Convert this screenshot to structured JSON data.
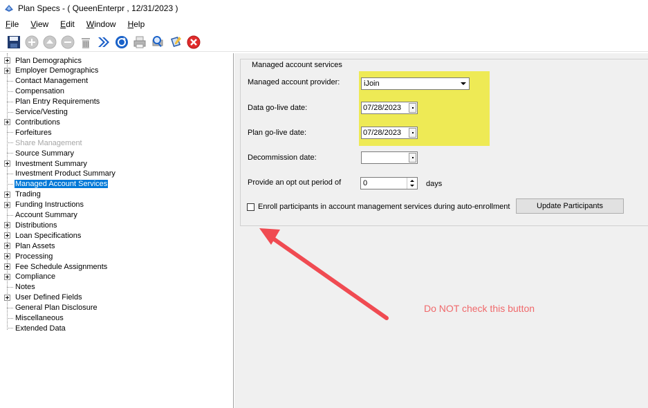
{
  "window": {
    "title": "Plan Specs -  ( QueenEnterpr , 12/31/2023 )",
    "app_icon": "plan-specs-app-icon"
  },
  "menu": {
    "items": [
      {
        "label": "File"
      },
      {
        "label": "View"
      },
      {
        "label": "Edit"
      },
      {
        "label": "Window"
      },
      {
        "label": "Help"
      }
    ]
  },
  "toolbar": {
    "buttons": [
      {
        "icon": "save-icon"
      },
      {
        "icon": "add-icon"
      },
      {
        "icon": "move-up-icon"
      },
      {
        "icon": "remove-icon"
      },
      {
        "icon": "delete-icon"
      },
      {
        "icon": "forward-icon"
      },
      {
        "icon": "refresh-icon"
      },
      {
        "icon": "print-icon"
      },
      {
        "icon": "print-preview-icon"
      },
      {
        "icon": "notes-icon"
      },
      {
        "icon": "close-icon"
      }
    ]
  },
  "tree": {
    "items": [
      {
        "label": "Plan Demographics",
        "expandable": true
      },
      {
        "label": "Employer Demographics",
        "expandable": true
      },
      {
        "label": "Contact Management",
        "expandable": false
      },
      {
        "label": "Compensation",
        "expandable": false
      },
      {
        "label": "Plan Entry Requirements",
        "expandable": false
      },
      {
        "label": "Service/Vesting",
        "expandable": false
      },
      {
        "label": "Contributions",
        "expandable": true
      },
      {
        "label": "Forfeitures",
        "expandable": false
      },
      {
        "label": "Share Management",
        "expandable": false,
        "disabled": true
      },
      {
        "label": "Source Summary",
        "expandable": false
      },
      {
        "label": "Investment Summary",
        "expandable": true
      },
      {
        "label": "Investment Product Summary",
        "expandable": false
      },
      {
        "label": "Managed Account Services",
        "expandable": false,
        "selected": true
      },
      {
        "label": "Trading",
        "expandable": true
      },
      {
        "label": "Funding Instructions",
        "expandable": true
      },
      {
        "label": "Account Summary",
        "expandable": false
      },
      {
        "label": "Distributions",
        "expandable": true
      },
      {
        "label": "Loan Specifications",
        "expandable": true
      },
      {
        "label": "Plan Assets",
        "expandable": true
      },
      {
        "label": "Processing",
        "expandable": true
      },
      {
        "label": "Fee Schedule Assignments",
        "expandable": true
      },
      {
        "label": "Compliance",
        "expandable": true
      },
      {
        "label": "Notes",
        "expandable": false
      },
      {
        "label": "User Defined Fields",
        "expandable": true
      },
      {
        "label": "General Plan Disclosure",
        "expandable": false
      },
      {
        "label": "Miscellaneous",
        "expandable": false
      },
      {
        "label": "Extended Data",
        "expandable": false
      }
    ]
  },
  "form": {
    "group_title": "Managed account services",
    "provider_label": "Managed account provider:",
    "provider_value": "iJoin",
    "data_golive_label": "Data go-live date:",
    "data_golive_value": "07/28/2023",
    "plan_golive_label": "Plan go-live date:",
    "plan_golive_value": "07/28/2023",
    "decommission_label": "Decommission date:",
    "decommission_value": "",
    "optout_label": "Provide an opt out period of",
    "optout_value": "0",
    "optout_unit": "days",
    "enroll_label": "Enroll participants in account management services during auto-enrollment",
    "enroll_checked": false,
    "update_button": "Update Participants",
    "highlight_color": "#eeea55"
  },
  "annotation": {
    "text": "Do NOT check this button",
    "color": "#f0696b",
    "arrow_color": "#f04b52"
  }
}
